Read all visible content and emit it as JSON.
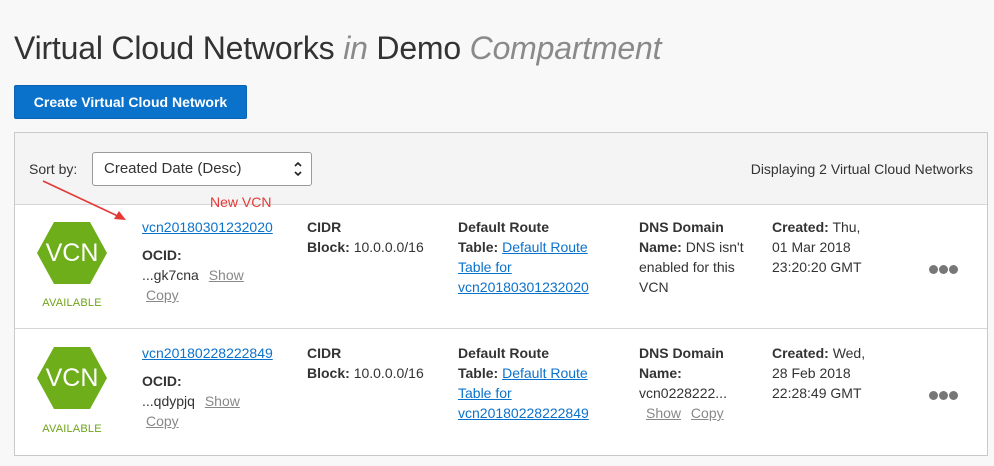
{
  "page": {
    "title_main": "Virtual Cloud Networks",
    "title_in": "in",
    "title_comp_name": "Demo",
    "title_comp_word": "Compartment"
  },
  "toolbar": {
    "create_label": "Create Virtual Cloud Network",
    "sort_label": "Sort by:",
    "sort_value": "Created Date (Desc)",
    "display_count": "Displaying 2 Virtual Cloud Networks"
  },
  "annotation": {
    "text": "New VCN",
    "color": "#e53935"
  },
  "icons": {
    "vcn_hex": "vcn-hexagon-icon",
    "hex_color": "#6fae1b",
    "more": "more-actions-icon"
  },
  "vcns": [
    {
      "name": "vcn20180301232020",
      "icon_text": "VCN",
      "status": "AVAILABLE",
      "ocid_label": "OCID:",
      "ocid_value": "...gk7cna",
      "show": "Show",
      "copy": "Copy",
      "cidr_label_1": "CIDR",
      "cidr_label_2": "Block:",
      "cidr_value": "10.0.0.0/16",
      "route_label_1": "Default Route",
      "route_label_2": "Table:",
      "route_link_1": "Default Route",
      "route_link_2": "Table for",
      "route_link_3": "vcn20180301232020",
      "dns_label_1": "DNS Domain",
      "dns_label_2": "Name:",
      "dns_value_1": "DNS isn't",
      "dns_value_2": "enabled for this",
      "dns_value_3": "VCN",
      "created_label": "Created:",
      "created_1": "Thu,",
      "created_2": "01 Mar 2018",
      "created_3": "23:20:20 GMT"
    },
    {
      "name": "vcn20180228222849",
      "icon_text": "VCN",
      "status": "AVAILABLE",
      "ocid_label": "OCID:",
      "ocid_value": "...qdypjq",
      "show": "Show",
      "copy": "Copy",
      "cidr_label_1": "CIDR",
      "cidr_label_2": "Block:",
      "cidr_value": "10.0.0.0/16",
      "route_label_1": "Default Route",
      "route_label_2": "Table:",
      "route_link_1": "Default Route",
      "route_link_2": "Table for",
      "route_link_3": "vcn20180228222849",
      "dns_label_1": "DNS Domain",
      "dns_label_2": "Name:",
      "dns_value_1": "vcn0228222...",
      "dns_show": "Show",
      "dns_copy": "Copy",
      "created_label": "Created:",
      "created_1": "Wed,",
      "created_2": "28 Feb 2018",
      "created_3": "22:28:49 GMT"
    }
  ]
}
